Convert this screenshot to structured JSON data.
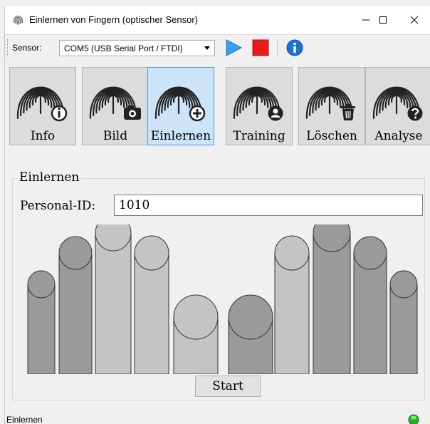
{
  "window": {
    "title": "Einlernen von Fingern (optischer Sensor)",
    "controls": {
      "minimize": "–",
      "maximize": "☐",
      "close": "✕"
    }
  },
  "toolbar": {
    "sensor_label": "Sensor:",
    "sensor_value": "COM5 (USB Serial Port / FTDI)",
    "play_icon": "play-icon",
    "stop_icon": "stop-icon",
    "info_icon": "info-icon",
    "colors": {
      "play": "#3aa0f0",
      "stop": "#e81c1c",
      "info": "#1a73d9"
    }
  },
  "tools": [
    {
      "label": "Info",
      "badge": "info"
    },
    {
      "label": "Bild",
      "badge": "camera"
    },
    {
      "label": "Einlernen",
      "badge": "plus",
      "active": true
    },
    {
      "label": "Training",
      "badge": "person"
    },
    {
      "label": "Löschen",
      "badge": "trash"
    },
    {
      "label": "Analyse",
      "badge": "question"
    }
  ],
  "group": {
    "title": "Einlernen",
    "personal_id_label": "Personal-ID:",
    "personal_id_value": "1010",
    "start_label": "Start"
  },
  "status": {
    "text": "Einlernen",
    "led_color": "#22b422"
  }
}
